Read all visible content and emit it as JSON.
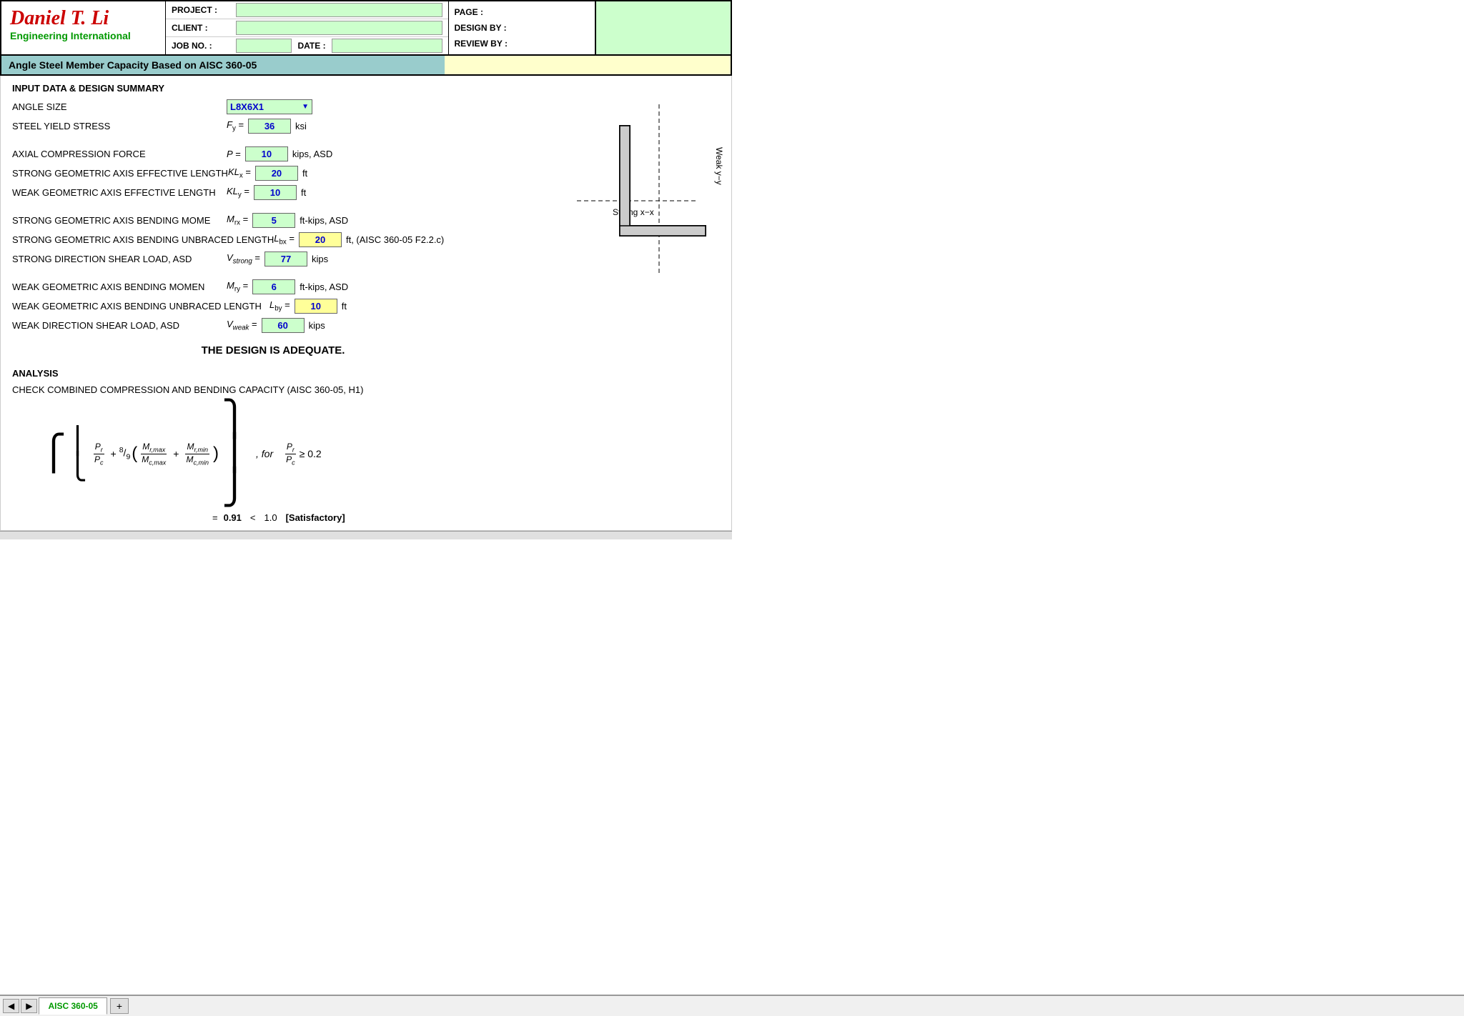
{
  "header": {
    "logo_title": "Daniel T. Li",
    "logo_subtitle": "Engineering International",
    "fields": {
      "project_label": "PROJECT :",
      "client_label": "CLIENT :",
      "jobno_label": "JOB NO. :",
      "date_label": "DATE :",
      "page_label": "PAGE :",
      "design_by_label": "DESIGN BY :",
      "review_by_label": "REVIEW BY :"
    }
  },
  "title_bar": "Angle Steel Member Capacity Based on AISC 360-05",
  "section": {
    "input_title": "INPUT DATA & DESIGN SUMMARY",
    "angle_size_label": "ANGLE SIZE",
    "angle_size_value": "L8X6X1",
    "steel_yield_label": "STEEL YIELD STRESS",
    "fy_symbol": "F",
    "fy_sub": "y",
    "fy_equals": "=",
    "fy_value": "36",
    "fy_unit": "ksi",
    "axial_label": "AXIAL COMPRESSION FORCE",
    "p_symbol": "P =",
    "p_value": "10",
    "p_unit": "kips, ASD",
    "strong_length_label": "STRONG GEOMETRIC AXIS EFFECTIVE LENGTH",
    "klx_symbol": "KL",
    "klx_sub": "x",
    "klx_equals": "=",
    "klx_value": "20",
    "klx_unit": "ft",
    "weak_length_label": "WEAK GEOMETRIC AXIS EFFECTIVE LENGTH",
    "kly_symbol": "KL",
    "kly_sub": "y",
    "kly_equals": "=",
    "kly_value": "10",
    "kly_unit": "ft",
    "strong_moment_label": "STRONG GEOMETRIC AXIS BENDING MOME",
    "mrx_symbol": "M",
    "mrx_sub": "rx",
    "mrx_equals": "=",
    "mrx_value": "5",
    "mrx_unit": "ft-kips, ASD",
    "strong_unbraced_label": "STRONG GEOMETRIC AXIS BENDING UNBRACED LENGTH",
    "lbx_symbol": "L",
    "lbx_sub": "bx",
    "lbx_equals": "=",
    "lbx_value": "20",
    "lbx_unit": "ft, (AISC 360-05 F2.2.c)",
    "strong_shear_label": "STRONG DIRECTION SHEAR LOAD, ASD",
    "vstrong_symbol": "V",
    "vstrong_sub": "strong",
    "vstrong_equals": "=",
    "vstrong_value": "77",
    "vstrong_unit": "kips",
    "weak_moment_label": "WEAK GEOMETRIC AXIS BENDING MOMEN",
    "mry_symbol": "M",
    "mry_sub": "ry",
    "mry_equals": "=",
    "mry_value": "6",
    "mry_unit": "ft-kips, ASD",
    "weak_unbraced_label": "WEAK GEOMETRIC AXIS BENDING UNBRACED LENGTH",
    "lby_symbol": "L",
    "lby_sub": "by",
    "lby_equals": "=",
    "lby_value": "10",
    "lby_unit": "ft",
    "weak_shear_label": "WEAK DIRECTION SHEAR LOAD, ASD",
    "vweak_symbol": "V",
    "vweak_sub": "weak",
    "vweak_equals": "=",
    "vweak_value": "60",
    "vweak_unit": "kips"
  },
  "design_result": "THE DESIGN IS ADEQUATE.",
  "analysis": {
    "title": "ANALYSIS",
    "subtitle": "CHECK COMBINED COMPRESSION AND BENDING CAPACITY (AISC 360-05, H1)",
    "formula_result_value": "0.91",
    "formula_result_lt": "<",
    "formula_result_limit": "1.0",
    "formula_result_status": "[Satisfactory]",
    "for_condition": "for",
    "condition": "≥ 0.2"
  },
  "tabs": {
    "active": "AISC 360-05",
    "add_label": "+"
  }
}
